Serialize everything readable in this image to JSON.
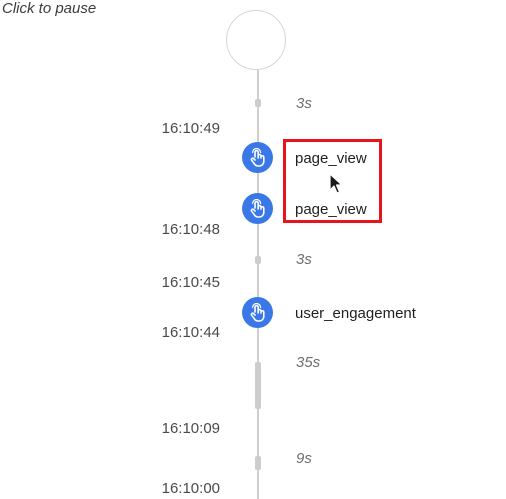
{
  "pause_label": "Click to pause",
  "colors": {
    "event_icon": "#3b78e7",
    "timeline": "#cfcfcf",
    "highlight": "#e8141c"
  },
  "timeline": {
    "durations": [
      "3s",
      "3s",
      "35s",
      "9s"
    ],
    "timestamps": [
      "16:10:49",
      "16:10:48",
      "16:10:45",
      "16:10:44",
      "16:10:09",
      "16:10:00"
    ],
    "events": [
      {
        "label": "page_view",
        "icon": "touch-icon"
      },
      {
        "label": "page_view",
        "icon": "touch-icon"
      },
      {
        "label": "user_engagement",
        "icon": "touch-icon"
      }
    ]
  }
}
